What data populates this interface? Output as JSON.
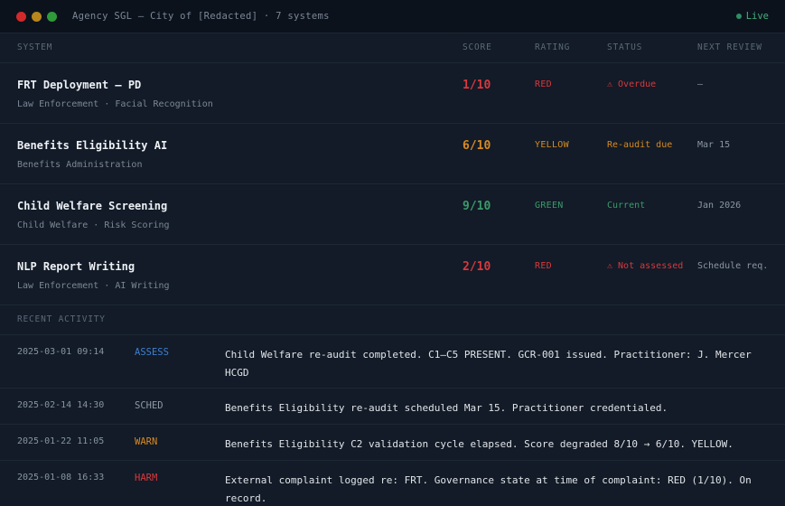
{
  "window": {
    "title": "Agency SGL — City of [Redacted] · 7 systems",
    "live_label": "Live",
    "controls": [
      "close",
      "minimize",
      "maximize"
    ]
  },
  "table": {
    "columns": {
      "system": "SYSTEM",
      "score": "SCORE",
      "rating": "RATING",
      "status": "STATUS",
      "review": "NEXT REVIEW"
    },
    "rows": [
      {
        "name": "FRT Deployment — PD",
        "subtitle": "Law Enforcement · Facial Recognition",
        "score": "1/10",
        "rating": "RED",
        "status": "⚠ Overdue",
        "review": "—"
      },
      {
        "name": "Benefits Eligibility AI",
        "subtitle": "Benefits Administration",
        "score": "6/10",
        "rating": "YELLOW",
        "status": "Re-audit due",
        "review": "Mar 15"
      },
      {
        "name": "Child Welfare Screening",
        "subtitle": "Child Welfare · Risk Scoring",
        "score": "9/10",
        "rating": "GREEN",
        "status": "Current",
        "review": "Jan 2026"
      },
      {
        "name": "NLP Report Writing",
        "subtitle": "Law Enforcement · AI Writing",
        "score": "2/10",
        "rating": "RED",
        "status": "⚠ Not assessed",
        "review": "Schedule req."
      }
    ]
  },
  "activity": {
    "label": "RECENT ACTIVITY",
    "items": [
      {
        "timestamp": "2025-03-01 09:14",
        "type": "ASSESS",
        "message": "Child Welfare re-audit completed. C1–C5 PRESENT. GCR-001 issued. Practitioner: J. Mercer HCGD"
      },
      {
        "timestamp": "2025-02-14 14:30",
        "type": "SCHED",
        "message": "Benefits Eligibility re-audit scheduled Mar 15. Practitioner credentialed."
      },
      {
        "timestamp": "2025-01-22 11:05",
        "type": "WARN",
        "message": "Benefits Eligibility C2 validation cycle elapsed. Score degraded 8/10 → 6/10. YELLOW."
      },
      {
        "timestamp": "2025-01-08 16:33",
        "type": "HARM",
        "message": "External complaint logged re: FRT. Governance state at time of complaint: RED (1/10). On record."
      }
    ]
  },
  "colors": {
    "red": "#d8383e",
    "yellow": "#d98a22",
    "green": "#3c9a6a",
    "assess": "#3f7fd0",
    "background": "#121b27",
    "titlebar": "#0b121c"
  }
}
